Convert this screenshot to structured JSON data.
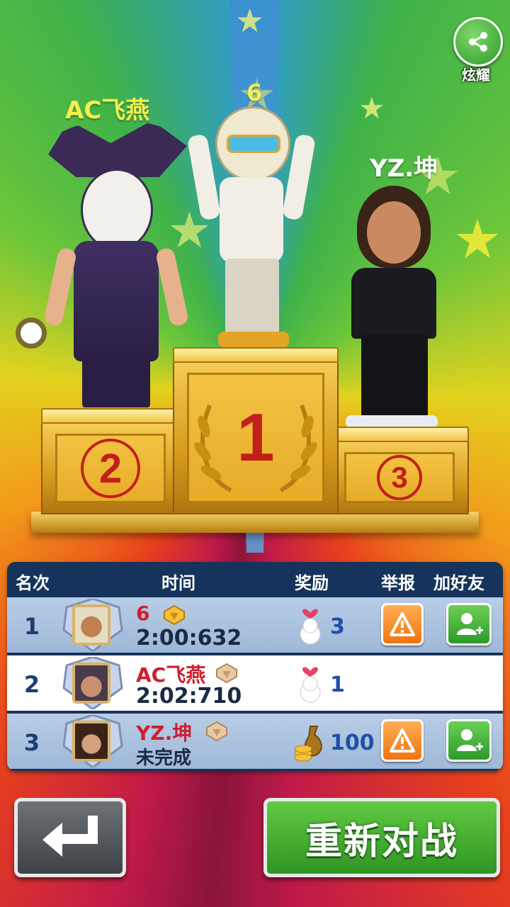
{
  "header": {
    "share_label": "炫耀",
    "share_icon": "share-icon"
  },
  "podium_players": {
    "first": "6",
    "second": "AC飞燕",
    "third": "YZ.坤"
  },
  "podium_ranks": [
    "1",
    "2",
    "3"
  ],
  "table": {
    "headers": {
      "rank": "名次",
      "time": "时间",
      "reward": "奖励",
      "report": "举报",
      "add_friend": "加好友"
    },
    "rows": [
      {
        "rank": "1",
        "name": "6",
        "time": "2:00:632",
        "reward_icon": "lucky-cat-icon",
        "reward": "3",
        "report": true,
        "add_friend": true
      },
      {
        "rank": "2",
        "name": "AC飞燕",
        "time": "2:02:710",
        "reward_icon": "lucky-cat-icon",
        "reward": "1",
        "report": false,
        "add_friend": false
      },
      {
        "rank": "3",
        "name": "YZ.坤",
        "time": "未完成",
        "reward_icon": "coin-bag-icon",
        "reward": "100",
        "report": true,
        "add_friend": true
      }
    ]
  },
  "footer": {
    "back_icon": "return-arrow-icon",
    "rematch_label": "重新对战"
  },
  "colors": {
    "header_bg": "#16345b",
    "name_red": "#cf1f2e",
    "report_orange": "#f0740f",
    "friend_green": "#2c9a2a"
  }
}
